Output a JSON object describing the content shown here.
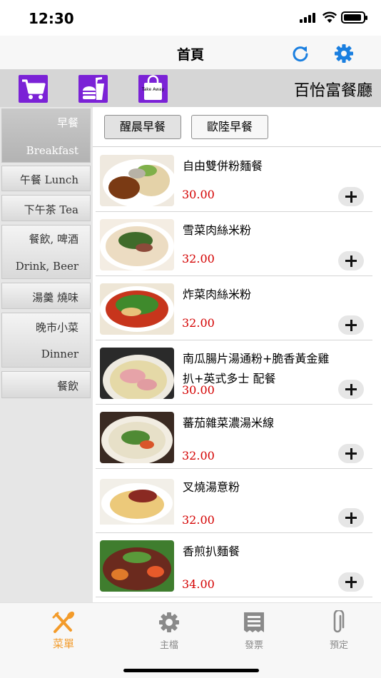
{
  "status": {
    "time": "12:30"
  },
  "nav": {
    "title": "首頁",
    "refresh_icon": "refresh-icon",
    "settings_icon": "gear-icon",
    "accent": "#1a7fe0"
  },
  "toolbar": {
    "restaurant_name": "百怡富餐廳",
    "icons": [
      "cart-icon",
      "fast-food-icon",
      "takeaway-bag-icon"
    ],
    "takeaway_text": "Take Away",
    "icon_color": "#7b22d6"
  },
  "categories": [
    {
      "line1": "早餐",
      "line2": "Breakfast",
      "active": true
    },
    {
      "line1": "午餐 Lunch"
    },
    {
      "line1": "下午茶 Tea"
    },
    {
      "line1": "餐飲, 啤酒",
      "line2": "Drink, Beer"
    },
    {
      "line1": "湯羹 燒味"
    },
    {
      "line1": "晚市小菜",
      "line2": "Dinner"
    },
    {
      "line1": "餐飲"
    }
  ],
  "subtabs": [
    {
      "label": "醒晨早餐",
      "active": true
    },
    {
      "label": "歐陸早餐"
    }
  ],
  "menu_items": [
    {
      "name": "自由雙併粉麵餐",
      "price": "30.00"
    },
    {
      "name": "雪菜肉絲米粉",
      "price": "32.00"
    },
    {
      "name": "炸菜肉絲米粉",
      "price": "32.00"
    },
    {
      "name": "南瓜腸片湯通粉+脆香黃金雞扒+英式多士 配餐",
      "price": "30.00"
    },
    {
      "name": "蕃茄雜菜濃湯米線",
      "price": "32.00"
    },
    {
      "name": "叉燒湯意粉",
      "price": "32.00"
    },
    {
      "name": "香煎扒麵餐",
      "price": "34.00"
    }
  ],
  "tabs": [
    {
      "label": "菜單",
      "icon": "utensils-icon",
      "active": true
    },
    {
      "label": "主檔",
      "icon": "gear-icon"
    },
    {
      "label": "發票",
      "icon": "receipt-icon"
    },
    {
      "label": "預定",
      "icon": "paperclip-icon"
    }
  ],
  "colors": {
    "price": "#d40000",
    "tab_active": "#f39b2a",
    "tab_inactive": "#8a8a8a"
  }
}
